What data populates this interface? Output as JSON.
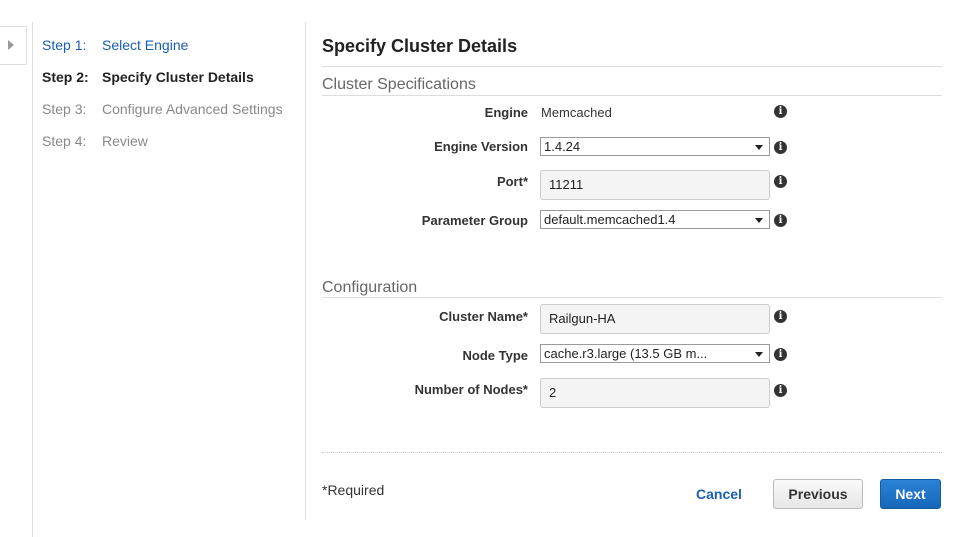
{
  "steps": [
    {
      "num": "Step 1:",
      "label": "Select Engine"
    },
    {
      "num": "Step 2:",
      "label": "Specify Cluster Details"
    },
    {
      "num": "Step 3:",
      "label": "Configure Advanced Settings"
    },
    {
      "num": "Step 4:",
      "label": "Review"
    }
  ],
  "main": {
    "title": "Specify Cluster Details",
    "cluster_specs": {
      "title": "Cluster Specifications",
      "engine_label": "Engine",
      "engine_value": "Memcached",
      "engine_version_label": "Engine Version",
      "engine_version_value": "1.4.24",
      "port_label": "Port*",
      "port_value": "11211",
      "param_group_label": "Parameter Group",
      "param_group_value": "default.memcached1.4"
    },
    "configuration": {
      "title": "Configuration",
      "cluster_name_label": "Cluster Name*",
      "cluster_name_value": "Railgun-HA",
      "node_type_label": "Node Type",
      "node_type_value": "cache.r3.large (13.5 GB m...",
      "num_nodes_label": "Number of Nodes*",
      "num_nodes_value": "2"
    }
  },
  "footer": {
    "required_note": "*Required",
    "cancel": "Cancel",
    "previous": "Previous",
    "next": "Next"
  },
  "info_glyph": "i",
  "colors": {
    "link": "#1a5fb4",
    "primary_button": "#1667b8",
    "muted_step": "#888888"
  }
}
